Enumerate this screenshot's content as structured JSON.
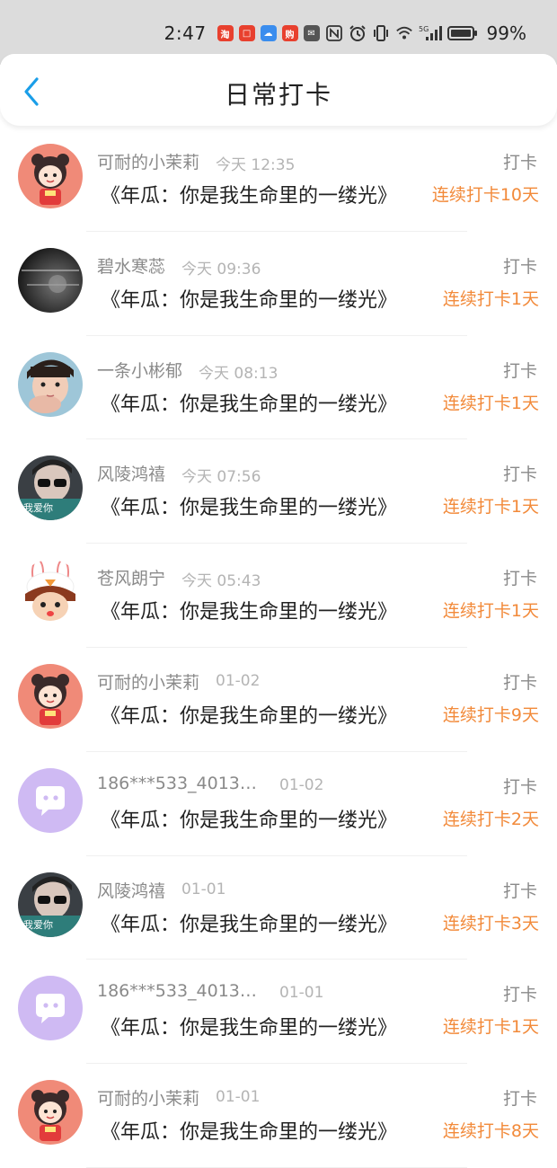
{
  "status_bar": {
    "time": "2:47",
    "battery": "99%",
    "app_icons": [
      {
        "name": "taobao-icon",
        "glyph": "淘",
        "color": "#e8402e"
      },
      {
        "name": "app-red-icon",
        "glyph": "□",
        "color": "#e8402e"
      },
      {
        "name": "cloud-app-icon",
        "glyph": "☁",
        "color": "#3a8dee"
      },
      {
        "name": "promo-app-icon",
        "glyph": "购",
        "color": "#e8402e"
      },
      {
        "name": "wechat-icon",
        "glyph": "✉",
        "color": "#555555"
      }
    ]
  },
  "header": {
    "title": "日常打卡"
  },
  "colors": {
    "accent": "#1a9ee8",
    "streak": "#f28a3a"
  },
  "checkins": [
    {
      "user": "可耐的小茉莉",
      "time": "今天 12:35",
      "label": "打卡",
      "book": "《年瓜：你是我生命里的一缕光》",
      "streak": "连续打卡10天",
      "avatar": "girl"
    },
    {
      "user": "碧水寒蕊",
      "time": "今天 09:36",
      "label": "打卡",
      "book": "《年瓜：你是我生命里的一缕光》",
      "streak": "连续打卡1天",
      "avatar": "dark"
    },
    {
      "user": "一条小彬郁",
      "time": "今天 08:13",
      "label": "打卡",
      "book": "《年瓜：你是我生命里的一缕光》",
      "streak": "连续打卡1天",
      "avatar": "boy"
    },
    {
      "user": "风陵鸿禧",
      "time": "今天 07:56",
      "label": "打卡",
      "book": "《年瓜：你是我生命里的一缕光》",
      "streak": "连续打卡1天",
      "avatar": "sunglasses"
    },
    {
      "user": "苍风朗宁",
      "time": "今天 05:43",
      "label": "打卡",
      "book": "《年瓜：你是我生命里的一缕光》",
      "streak": "连续打卡1天",
      "avatar": "bunny"
    },
    {
      "user": "可耐的小茉莉",
      "time": "01-02",
      "label": "打卡",
      "book": "《年瓜：你是我生命里的一缕光》",
      "streak": "连续打卡9天",
      "avatar": "girl"
    },
    {
      "user": "186***533_40130...",
      "time": "01-02",
      "label": "打卡",
      "book": "《年瓜：你是我生命里的一缕光》",
      "streak": "连续打卡2天",
      "avatar": "default"
    },
    {
      "user": "风陵鸿禧",
      "time": "01-01",
      "label": "打卡",
      "book": "《年瓜：你是我生命里的一缕光》",
      "streak": "连续打卡3天",
      "avatar": "sunglasses"
    },
    {
      "user": "186***533_40130...",
      "time": "01-01",
      "label": "打卡",
      "book": "《年瓜：你是我生命里的一缕光》",
      "streak": "连续打卡1天",
      "avatar": "default"
    },
    {
      "user": "可耐的小茉莉",
      "time": "01-01",
      "label": "打卡",
      "book": "《年瓜：你是我生命里的一缕光》",
      "streak": "连续打卡8天",
      "avatar": "girl"
    }
  ]
}
